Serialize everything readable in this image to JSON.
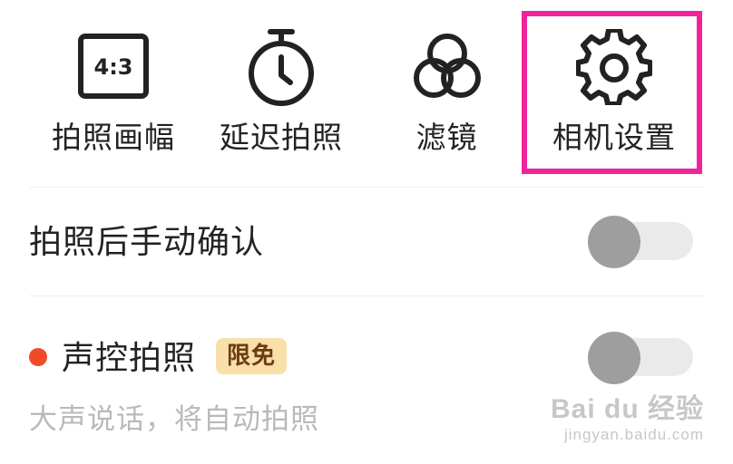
{
  "toolbar": {
    "items": [
      {
        "label": "拍照画幅",
        "icon": "aspect-ratio-icon",
        "icon_text": "4:3"
      },
      {
        "label": "延迟拍照",
        "icon": "timer-icon"
      },
      {
        "label": "滤镜",
        "icon": "filter-icon"
      },
      {
        "label": "相机设置",
        "icon": "gear-icon",
        "highlighted": true
      }
    ],
    "highlight_color": "#f0239c"
  },
  "settings": {
    "manual_confirm": {
      "title": "拍照后手动确认",
      "enabled": false
    },
    "voice_control": {
      "title": "声控拍照",
      "badge": "限免",
      "subtitle": "大声说话，将自动拍照",
      "enabled": false,
      "dot_color": "#f04a2a"
    }
  },
  "watermark": {
    "brand": "Bai du 经验",
    "url": "jingyan.baidu.com"
  }
}
